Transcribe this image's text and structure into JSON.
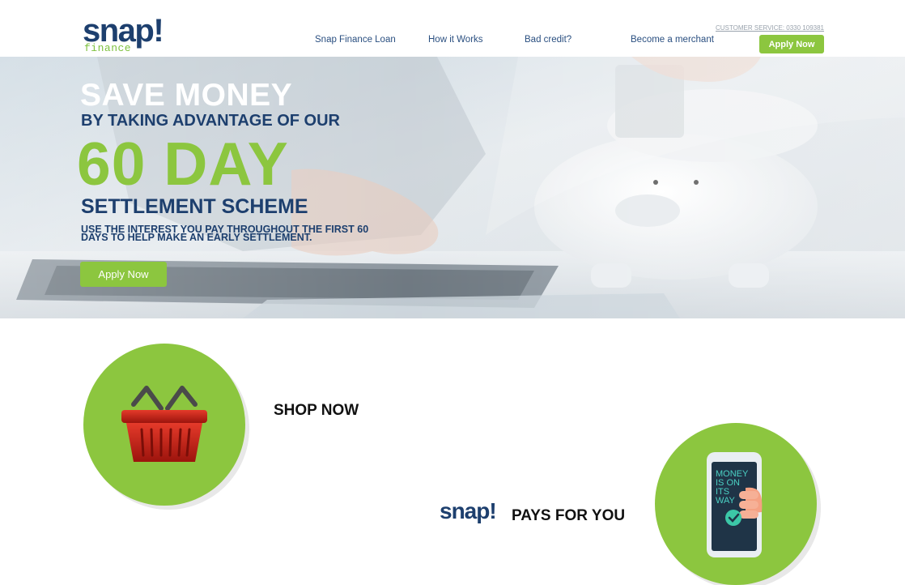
{
  "brand": {
    "logo_word": "snap!",
    "logo_sub": "finance",
    "primary_color": "#1d3f6e",
    "accent_color": "#8cc63f"
  },
  "header": {
    "nav": [
      "Snap Finance Loan",
      "How it Works",
      "Bad credit?",
      "Become a merchant"
    ],
    "customer_service": "CUSTOMER SERVICE: 0330 109381",
    "apply_label": "Apply Now"
  },
  "hero": {
    "line1": "SAVE MONEY",
    "line2": "BY TAKING ADVANTAGE OF OUR",
    "line3": "60 DAY",
    "line4": "SETTLEMENT SCHEME",
    "line5": "USE THE INTEREST YOU PAY THROUGHOUT THE FIRST 60 DAYS TO HELP MAKE AN EARLY SETTLEMENT.",
    "apply_label": "Apply Now"
  },
  "steps": {
    "shop_label": "SHOP NOW",
    "snap_word": "snap!",
    "pays_label": "PAYS FOR YOU",
    "phone_text": [
      "MONEY",
      "IS ON",
      "ITS",
      "WAY"
    ]
  }
}
